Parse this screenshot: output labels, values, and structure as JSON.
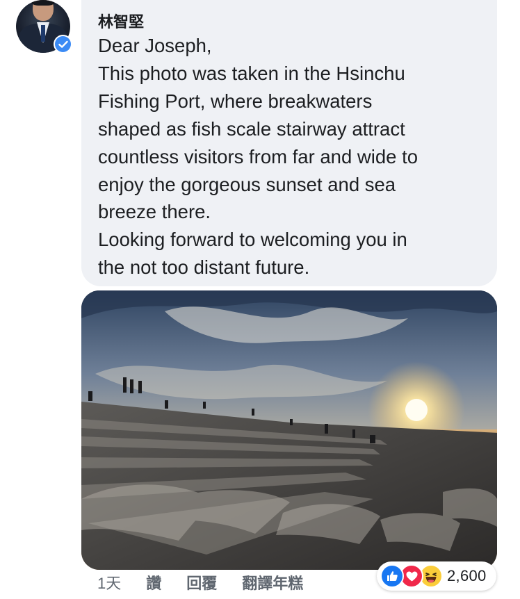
{
  "comment": {
    "author": "林智堅",
    "verified": true,
    "message_lines": [
      "Dear Joseph,",
      "This photo was taken in the Hsinchu",
      "Fishing Port, where breakwaters",
      "shaped as fish scale stairway attract",
      "countless visitors from far and wide to",
      "enjoy the gorgeous sunset and sea",
      "breeze there.",
      "Looking forward to welcoming you in",
      "the not too distant future."
    ]
  },
  "attachment": {
    "kind": "photo",
    "subject": "sunset over stepped breakwater at fishing port"
  },
  "actions": {
    "age": "1天",
    "like": "讚",
    "reply": "回覆",
    "translate": "翻譯年糕"
  },
  "reactions": {
    "types": [
      "like-icon",
      "love-icon",
      "haha-icon"
    ],
    "count": "2,600"
  },
  "colors": {
    "bubble_bg": "#eff1f5",
    "text": "#1c1e21",
    "meta_text": "#606770",
    "verified_blue": "#3b8bf5",
    "like_blue": "#1877f2",
    "love_red": "#f0284a",
    "haha_yellow": "#fbcd3a"
  }
}
